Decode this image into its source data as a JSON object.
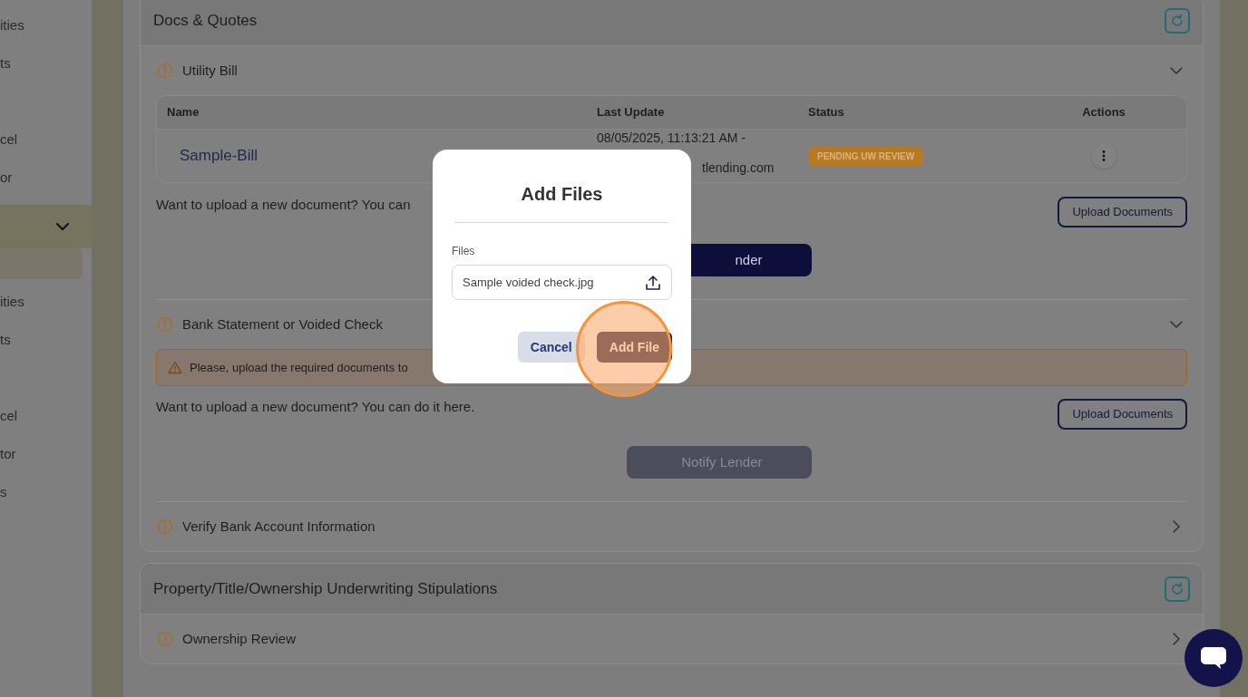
{
  "sidebar": {
    "items": [
      {
        "label": "ities",
        "selected": false
      },
      {
        "label": "ts",
        "selected": false
      },
      {
        "label": "cel",
        "selected": false
      },
      {
        "label": "or",
        "selected": false
      }
    ],
    "group": {
      "expanded": true,
      "items": [
        {
          "selected": true
        },
        {
          "label": "ities",
          "selected": false
        },
        {
          "label": "ts",
          "selected": false
        },
        {
          "label": "cel",
          "selected": false
        },
        {
          "label": "tor",
          "selected": false
        },
        {
          "label": "s",
          "selected": false
        }
      ]
    }
  },
  "cards": [
    {
      "title": "Docs & Quotes",
      "sections": [
        {
          "title": "Utility Bill",
          "expanded": true,
          "table": {
            "columns": [
              "Name",
              "Last Update",
              "Status",
              "Actions"
            ],
            "rows": [
              {
                "name": "Sample-Bill",
                "last_update": [
                  "08/05/2025, 11:13:21 AM -",
                  "tlending.com"
                ],
                "status": "PENDING UW REVIEW"
              }
            ]
          },
          "prompt": "Want to upload a new document? You can",
          "upload_button": "Upload Documents",
          "notify_button": {
            "label": "nder",
            "disabled": false
          }
        },
        {
          "title": "Bank Statement or Voided Check",
          "expanded": true,
          "warning": "Please, upload the required documents to",
          "prompt": "Want to upload a new document? You can do it here.",
          "upload_button": "Upload Documents",
          "notify_button": {
            "label": "Notify Lender",
            "disabled": true
          }
        },
        {
          "title": "Verify Bank Account Information",
          "expanded": false
        }
      ]
    },
    {
      "title": "Property/Title/Ownership Underwriting Stipulations",
      "sections": [
        {
          "title": "Ownership Review",
          "expanded": false
        }
      ]
    }
  ],
  "modal": {
    "title": "Add Files",
    "field_label": "Files",
    "file_value": "Sample voided check.jpg",
    "buttons": [
      {
        "label": "Cancel",
        "kind": "secondary"
      },
      {
        "label": "Add File",
        "kind": "primary"
      }
    ]
  }
}
